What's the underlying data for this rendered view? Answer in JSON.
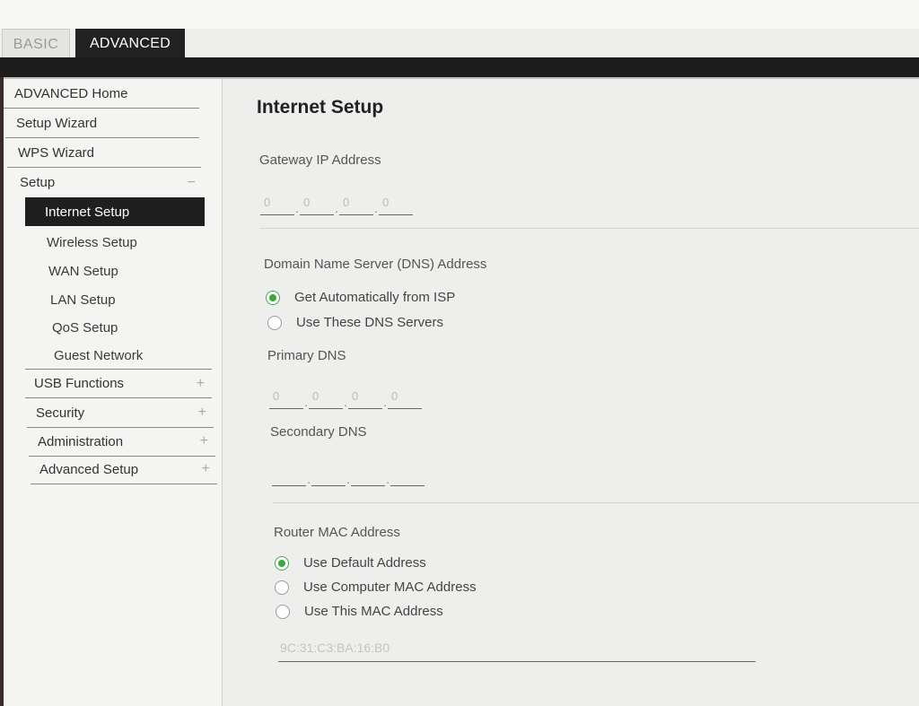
{
  "tabs": {
    "basic": "BASIC",
    "advanced": "ADVANCED"
  },
  "sidebar": {
    "items": [
      {
        "label": "ADVANCED Home"
      },
      {
        "label": "Setup Wizard"
      },
      {
        "label": "WPS Wizard"
      },
      {
        "label": "Setup",
        "toggle": "−"
      }
    ],
    "setup_subitems": [
      {
        "label": "Internet Setup",
        "active": true
      },
      {
        "label": "Wireless Setup"
      },
      {
        "label": "WAN Setup"
      },
      {
        "label": "LAN Setup"
      },
      {
        "label": "QoS Setup"
      },
      {
        "label": "Guest Network"
      }
    ],
    "sections": [
      {
        "label": "USB Functions",
        "toggle": "+"
      },
      {
        "label": "Security",
        "toggle": "+"
      },
      {
        "label": "Administration",
        "toggle": "+"
      },
      {
        "label": "Advanced Setup",
        "toggle": "+"
      }
    ]
  },
  "main": {
    "title": "Internet Setup",
    "gateway": {
      "label": "Gateway IP Address",
      "octets": [
        "0",
        "0",
        "0",
        "0"
      ]
    },
    "dns": {
      "label": "Domain Name Server (DNS) Address",
      "options": [
        "Get Automatically from ISP",
        "Use These DNS Servers"
      ],
      "selected": 0,
      "primary_label": "Primary DNS",
      "primary_octets": [
        "0",
        "0",
        "0",
        "0"
      ],
      "secondary_label": "Secondary DNS",
      "secondary_octets": [
        "",
        "",
        "",
        ""
      ]
    },
    "mac": {
      "label": "Router MAC Address",
      "options": [
        "Use Default Address",
        "Use Computer MAC Address",
        "Use This MAC Address"
      ],
      "selected": 0,
      "value": "9C:31:C3:BA:16:B0"
    }
  },
  "colors": {
    "accent_green": "#3aa83a",
    "header": "#1c1c1c",
    "active_nav": "#1f1f1f"
  }
}
